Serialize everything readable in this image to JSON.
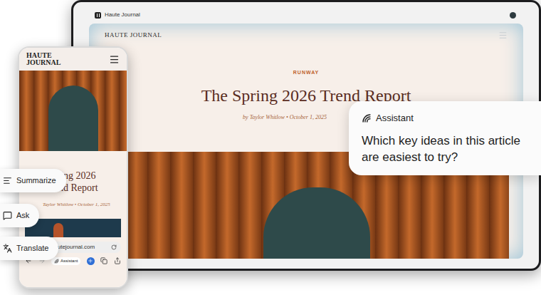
{
  "browser": {
    "tab_title": "Haute Journal",
    "site_name": "HAUTE JOURNAL",
    "article": {
      "category": "RUNWAY",
      "title": "The Spring 2026 Trend Report",
      "byline": "by Taylor Whitlow • October 1, 2025"
    }
  },
  "phone": {
    "site_name_lines": [
      "HAUTE",
      "JOURNAL"
    ],
    "title_lines": [
      "ing 2026",
      "Trend Report"
    ],
    "byline": "Taylor Whitlow • October 1, 2025",
    "url": "hautejournal.com",
    "toolbar_button": "Assistant"
  },
  "assistant": {
    "label": "Assistant",
    "question": "Which key ideas in this article are easiest to try?"
  },
  "actions": [
    {
      "label": "Summarize",
      "kind": "summarize"
    },
    {
      "label": "Ask",
      "kind": "ask"
    },
    {
      "label": "Translate",
      "kind": "translate"
    }
  ]
}
